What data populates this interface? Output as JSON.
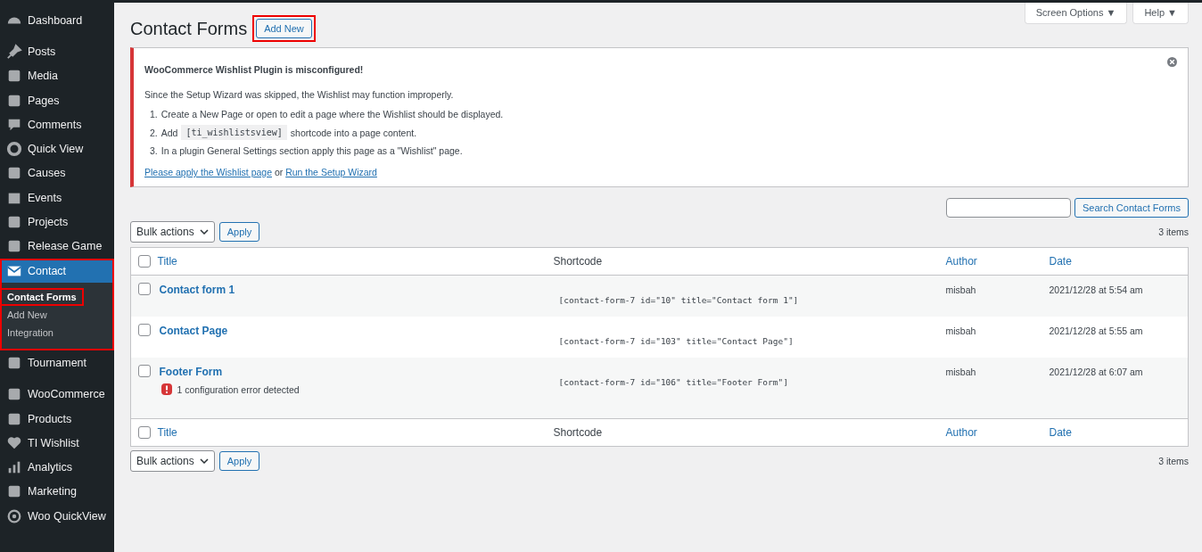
{
  "sidebar": {
    "items": [
      {
        "label": "Dashboard",
        "selected": false
      },
      {
        "label": "Posts",
        "selected": false
      },
      {
        "label": "Media",
        "selected": false
      },
      {
        "label": "Pages",
        "selected": false
      },
      {
        "label": "Comments",
        "selected": false
      },
      {
        "label": "Quick View",
        "selected": false
      },
      {
        "label": "Causes",
        "selected": false
      },
      {
        "label": "Events",
        "selected": false
      },
      {
        "label": "Projects",
        "selected": false
      },
      {
        "label": "Release Game",
        "selected": false
      },
      {
        "label": "Contact",
        "selected": true,
        "highlighted": true,
        "children": [
          {
            "label": "Contact Forms",
            "selected": true,
            "highlighted": true
          },
          {
            "label": "Add New",
            "selected": false,
            "highlighted": false
          },
          {
            "label": "Integration",
            "selected": false,
            "highlighted": false
          }
        ]
      },
      {
        "label": "Tournament",
        "selected": false
      },
      {
        "label": "WooCommerce",
        "selected": false
      },
      {
        "label": "Products",
        "selected": false
      },
      {
        "label": "TI Wishlist",
        "selected": false
      },
      {
        "label": "Analytics",
        "selected": false
      },
      {
        "label": "Marketing",
        "selected": false
      },
      {
        "label": "Woo QuickView",
        "selected": false
      }
    ]
  },
  "screen_tabs": [
    "Screen Options ▼",
    "Help ▼"
  ],
  "page_title": "Contact Forms",
  "add_new": {
    "label": "Add New",
    "highlighted": true
  },
  "notice": {
    "title": "WooCommerce Wishlist Plugin is misconfigured!",
    "text": "Since the Setup Wizard was skipped, the Wishlist may function improperly.",
    "steps": [
      {
        "number": "1.",
        "before": "Create a New Page or open to edit a page where the Wishlist should be displayed."
      },
      {
        "number": "2.",
        "before": "Add",
        "code": "[ti_wishlistsview]",
        "after": "shortcode into a page content."
      },
      {
        "number": "3.",
        "before": "In a plugin General Settings section apply this page as a \"Wishlist\" page."
      }
    ],
    "link_1": "Please apply the Wishlist page",
    "joiner": "or",
    "link_2": "Run the Setup Wizard"
  },
  "search": {
    "button": "Search Contact Forms"
  },
  "bulk_actions": "Bulk actions",
  "apply": "Apply",
  "items_count": "3 items",
  "table": {
    "select_all_checked": false,
    "footer_select_all_checked": false,
    "columns": [
      "Title",
      "Shortcode",
      "Author",
      "Date"
    ],
    "footer_columns": [
      "Title",
      "Shortcode",
      "Author",
      "Date"
    ],
    "rows": [
      {
        "checked": false,
        "title": "Contact form 1",
        "shortcode": "[contact-form-7 id=\"10\" title=\"Contact form 1\"]",
        "author": "misbah",
        "date": "2021/12/28 at 5:54 am"
      },
      {
        "checked": false,
        "title": "Contact Page",
        "shortcode": "[contact-form-7 id=\"103\" title=\"Contact Page\"]",
        "author": "misbah",
        "date": "2021/12/28 at 5:55 am"
      },
      {
        "checked": false,
        "title": "Footer Form",
        "error": "1 configuration error detected",
        "shortcode": "[contact-form-7 id=\"106\" title=\"Footer Form\"]",
        "author": "misbah",
        "date": "2021/12/28 at 6:07 am"
      }
    ]
  },
  "bottom_bulk_actions": "Bulk actions",
  "bottom_apply": "Apply",
  "bottom_items_count": "3 items"
}
